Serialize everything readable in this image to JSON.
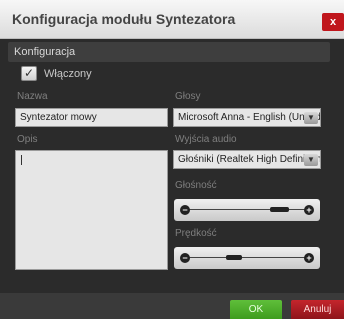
{
  "dialog": {
    "title": "Konfiguracja modułu Syntezatora",
    "close_label": "x"
  },
  "section": {
    "title": "Konfiguracja"
  },
  "enabled": {
    "checked": true,
    "check_glyph": "✓",
    "label": "Włączony"
  },
  "name_field": {
    "label": "Nazwa",
    "value": "Syntezator mowy"
  },
  "description": {
    "label": "Opis",
    "value": ""
  },
  "voices": {
    "label": "Głosy",
    "selected": "Microsoft Anna - English (United"
  },
  "audio_output": {
    "label": "Wyjścia audio",
    "selected": "Głośniki (Realtek High Definition A"
  },
  "volume": {
    "label": "Głośność",
    "level": 0.9
  },
  "speed": {
    "label": "Prędkość",
    "level": 0.45
  },
  "buttons": {
    "ok": "OK",
    "cancel": "Anuluj"
  },
  "icons": {
    "dropdown": "chevron-down-icon",
    "minus": "minus-icon",
    "plus": "plus-icon"
  },
  "colors": {
    "ok": "#4caf2a",
    "cancel": "#b01e24",
    "close": "#c0161c"
  }
}
